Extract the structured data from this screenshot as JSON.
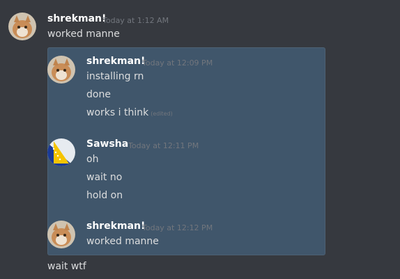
{
  "outer": {
    "author": "shrekman!",
    "timestamp": "Today at 1:12 AM",
    "message": "worked manne",
    "followup": "wait wtf",
    "author_color": "#ffffff"
  },
  "quoted": {
    "groups": [
      {
        "author": "shrekman!",
        "timestamp": "Today at 12:09 PM",
        "messages": [
          "installing rn",
          "done",
          "works i think"
        ],
        "edited_label": "(edited)"
      },
      {
        "author": "Sawsha",
        "timestamp": "Today at 12:11 PM",
        "messages": [
          "oh",
          "wait no",
          "hold on"
        ]
      },
      {
        "author": "shrekman!",
        "timestamp": "Today at 12:12 PM",
        "messages": [
          "worked manne"
        ]
      }
    ],
    "background": "#40566b"
  },
  "icons": {
    "shrekman_avatar": "cat-avatar-icon",
    "sawsha_avatar": "bosnia-flag-avatar-icon"
  }
}
